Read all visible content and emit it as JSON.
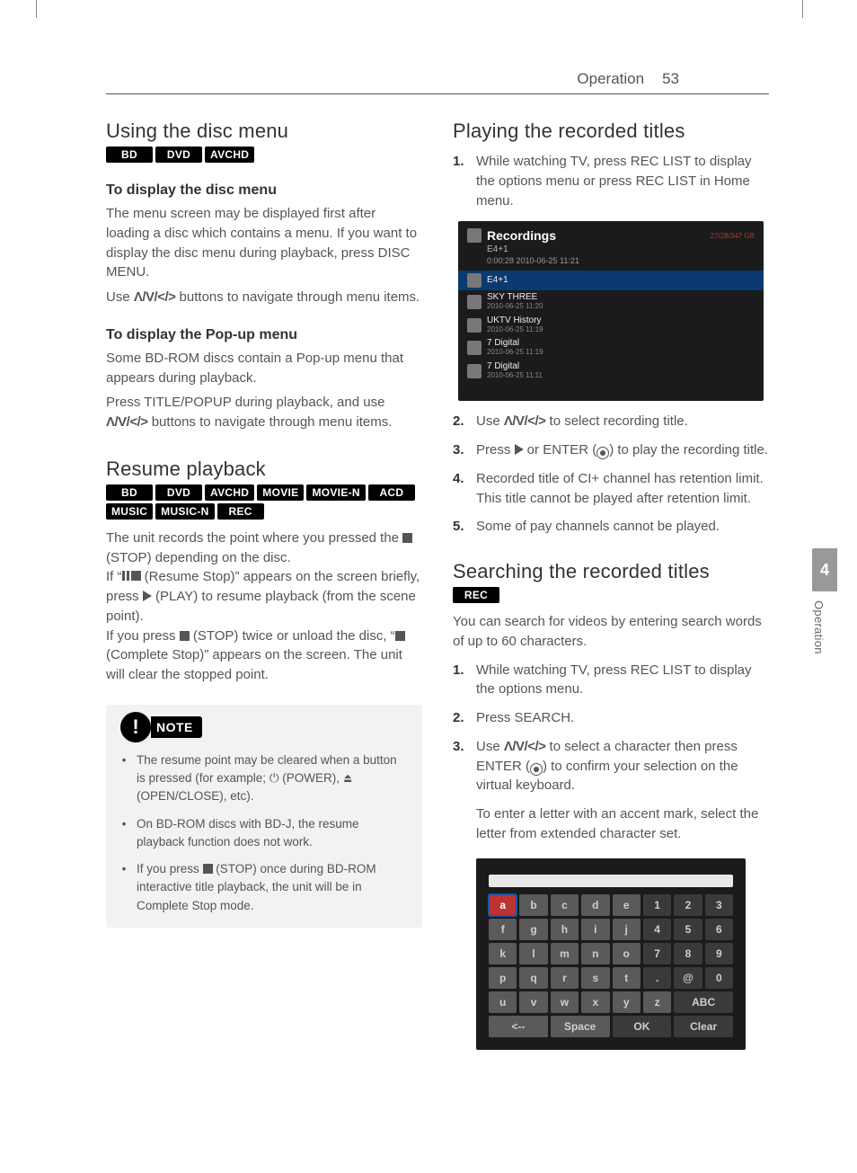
{
  "header": {
    "section": "Operation",
    "page": "53"
  },
  "sidebar": {
    "num": "4",
    "label": "Operation"
  },
  "left": {
    "s1": {
      "title": "Using the disc menu",
      "labels": [
        "BD",
        "DVD",
        "AVCHD"
      ],
      "h1": "To display the disc menu",
      "p1": "The menu screen may be displayed first after loading a disc which contains a menu. If you want to display the disc menu during playback, press DISC MENU.",
      "p2a": "Use ",
      "p2_arrows": "Λ/V/</>",
      "p2b": " buttons to navigate through menu items.",
      "h2": "To display the Pop-up menu",
      "p3": "Some BD-ROM discs contain a Pop-up menu that appears during playback.",
      "p4a": "Press TITLE/POPUP during playback, and use ",
      "p4_arrows": "Λ/V/</>",
      "p4b": " buttons to navigate through menu items."
    },
    "s2": {
      "title": "Resume playback",
      "labels": [
        "BD",
        "DVD",
        "AVCHD",
        "MOVIE",
        "MOVIE-N",
        "ACD",
        "MUSIC",
        "MUSIC-N",
        "REC"
      ],
      "p1a": "The unit records the point where you pressed the ",
      "p1b": " (STOP) depending on the disc.",
      "p2a": "If “",
      "p2b": " (Resume Stop)” appears on the screen briefly, press ",
      "p2c": " (PLAY)  to resume playback (from the scene point).",
      "p3a": "If you press ",
      "p3b": " (STOP) twice or unload the disc, “",
      "p3c": " (Complete Stop)” appears on the screen. The unit will clear the stopped point."
    },
    "note": {
      "label": "NOTE",
      "items": [
        {
          "a": "The resume point may be cleared when a button is pressed (for example; ",
          "b": " (POWER), ",
          "c": " (OPEN/CLOSE), etc)."
        },
        {
          "a": "On BD-ROM discs with BD-J, the resume playback function does not work."
        },
        {
          "a": "If you press ",
          "b": " (STOP) once during BD-ROM interactive title playback, the unit will be in Complete Stop mode."
        }
      ]
    }
  },
  "right": {
    "s1": {
      "title": "Playing the recorded titles",
      "li1": "While watching TV, press REC LIST to display the options menu or press REC LIST in Home menu.",
      "li2a": "Use ",
      "li2_arrows": "Λ/V/</>",
      "li2b": " to select recording title.",
      "li3a": "Press ",
      "li3b": " or ENTER (",
      "li3c": ") to play the recording title.",
      "li4": "Recorded title of CI+ channel has retention limit. This title cannot be played after retention limit.",
      "li5": "Some of pay channels cannot be played."
    },
    "shot1": {
      "title": "Recordings",
      "sig": "27/28/347 GB",
      "sub": "E4+1",
      "sub2": "0:00:28  2010-06-25 11:21",
      "rows": [
        {
          "t": "E4+1",
          "d": "",
          "sel": true
        },
        {
          "t": "SKY THREE",
          "d": "2010-06-25 11:20"
        },
        {
          "t": "UKTV History",
          "d": "2010-06-25 11:19"
        },
        {
          "t": "7 Digital",
          "d": "2010-06-25 11:19"
        },
        {
          "t": "7 Digital",
          "d": "2010-06-25 11:11"
        }
      ]
    },
    "s2": {
      "title": "Searching the recorded titles",
      "labels": [
        "REC"
      ],
      "p1": "You can search for videos by entering search words of up to 60 characters.",
      "li1": "While watching TV, press REC LIST to display the options menu.",
      "li2": "Press SEARCH.",
      "li3a": "Use ",
      "li3_arrows": "Λ/V/</>",
      "li3b": "  to select a character then press ENTER (",
      "li3c": ") to confirm your selection on the virtual keyboard.",
      "p2": "To enter a letter with an accent mark, select the letter from extended character set."
    },
    "kb": {
      "rows": [
        [
          "a",
          "b",
          "c",
          "d",
          "e",
          "1",
          "2",
          "3"
        ],
        [
          "f",
          "g",
          "h",
          "i",
          "j",
          "4",
          "5",
          "6"
        ],
        [
          "k",
          "l",
          "m",
          "n",
          "o",
          "7",
          "8",
          "9"
        ],
        [
          "p",
          "q",
          "r",
          "s",
          "t",
          ".",
          "@",
          "0"
        ],
        [
          "u",
          "v",
          "w",
          "x",
          "y",
          "z",
          "ABC"
        ],
        [
          "<--",
          "Space",
          "OK",
          "Clear"
        ]
      ]
    }
  }
}
